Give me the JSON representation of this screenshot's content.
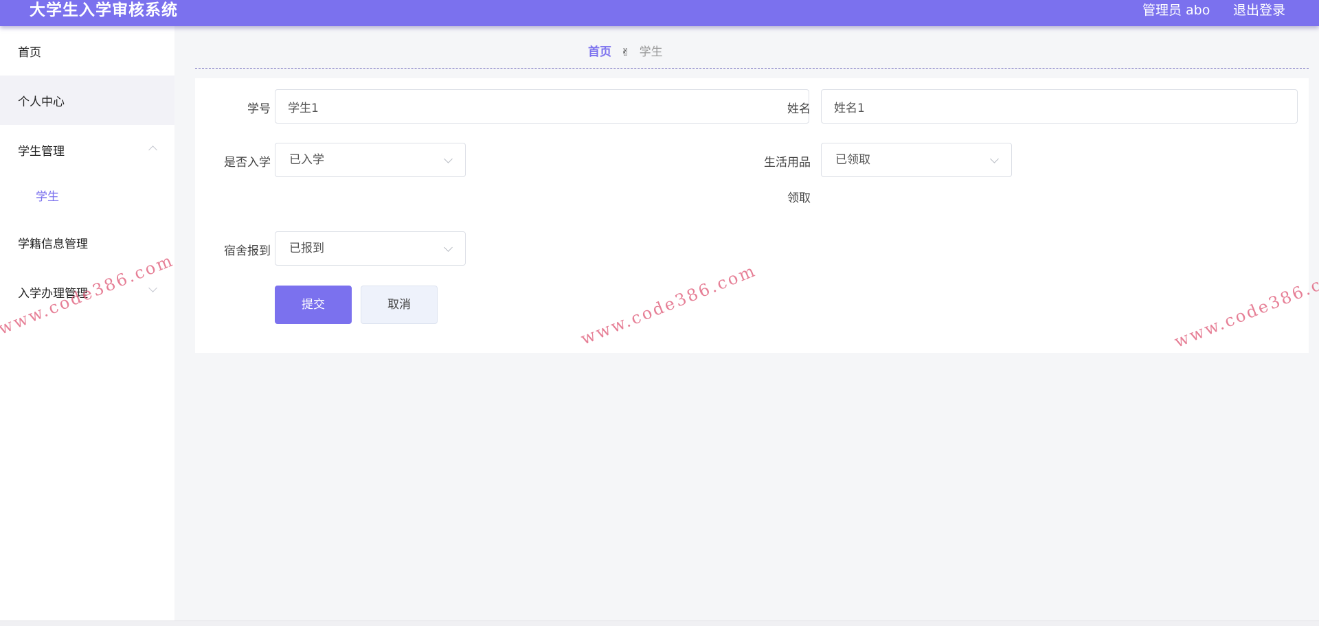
{
  "header": {
    "app_title": "大学生入学审核系统",
    "admin_label": "管理员 abo",
    "logout_label": "退出登录"
  },
  "sidebar": {
    "items": [
      {
        "label": "首页"
      },
      {
        "label": "个人中心"
      },
      {
        "label": "学生管理",
        "expanded": true,
        "children": [
          {
            "label": "学生"
          }
        ]
      },
      {
        "label": "学籍信息管理"
      },
      {
        "label": "入学办理管理",
        "expanded": false
      }
    ]
  },
  "breadcrumb": {
    "home": "首页",
    "separator_icon": "victory-hand-icon",
    "separator_glyph": "✌",
    "current": "学生"
  },
  "form": {
    "student_id": {
      "label": "学号",
      "value": "学生1"
    },
    "name": {
      "label": "姓名",
      "value": "姓名1"
    },
    "enrolled": {
      "label": "是否入学",
      "value": "已入学"
    },
    "supplies": {
      "label_line1": "生活用品",
      "label_line2": "领取",
      "value": "已领取"
    },
    "dorm_checkin": {
      "label": "宿舍报到",
      "value": "已报到"
    },
    "submit_label": "提交",
    "cancel_label": "取消"
  },
  "watermark": {
    "url_text": "www.code386.com"
  },
  "colors": {
    "brand": "#7b71ee",
    "header_bg": "#7b71ee",
    "watermark": "#e0607c"
  }
}
